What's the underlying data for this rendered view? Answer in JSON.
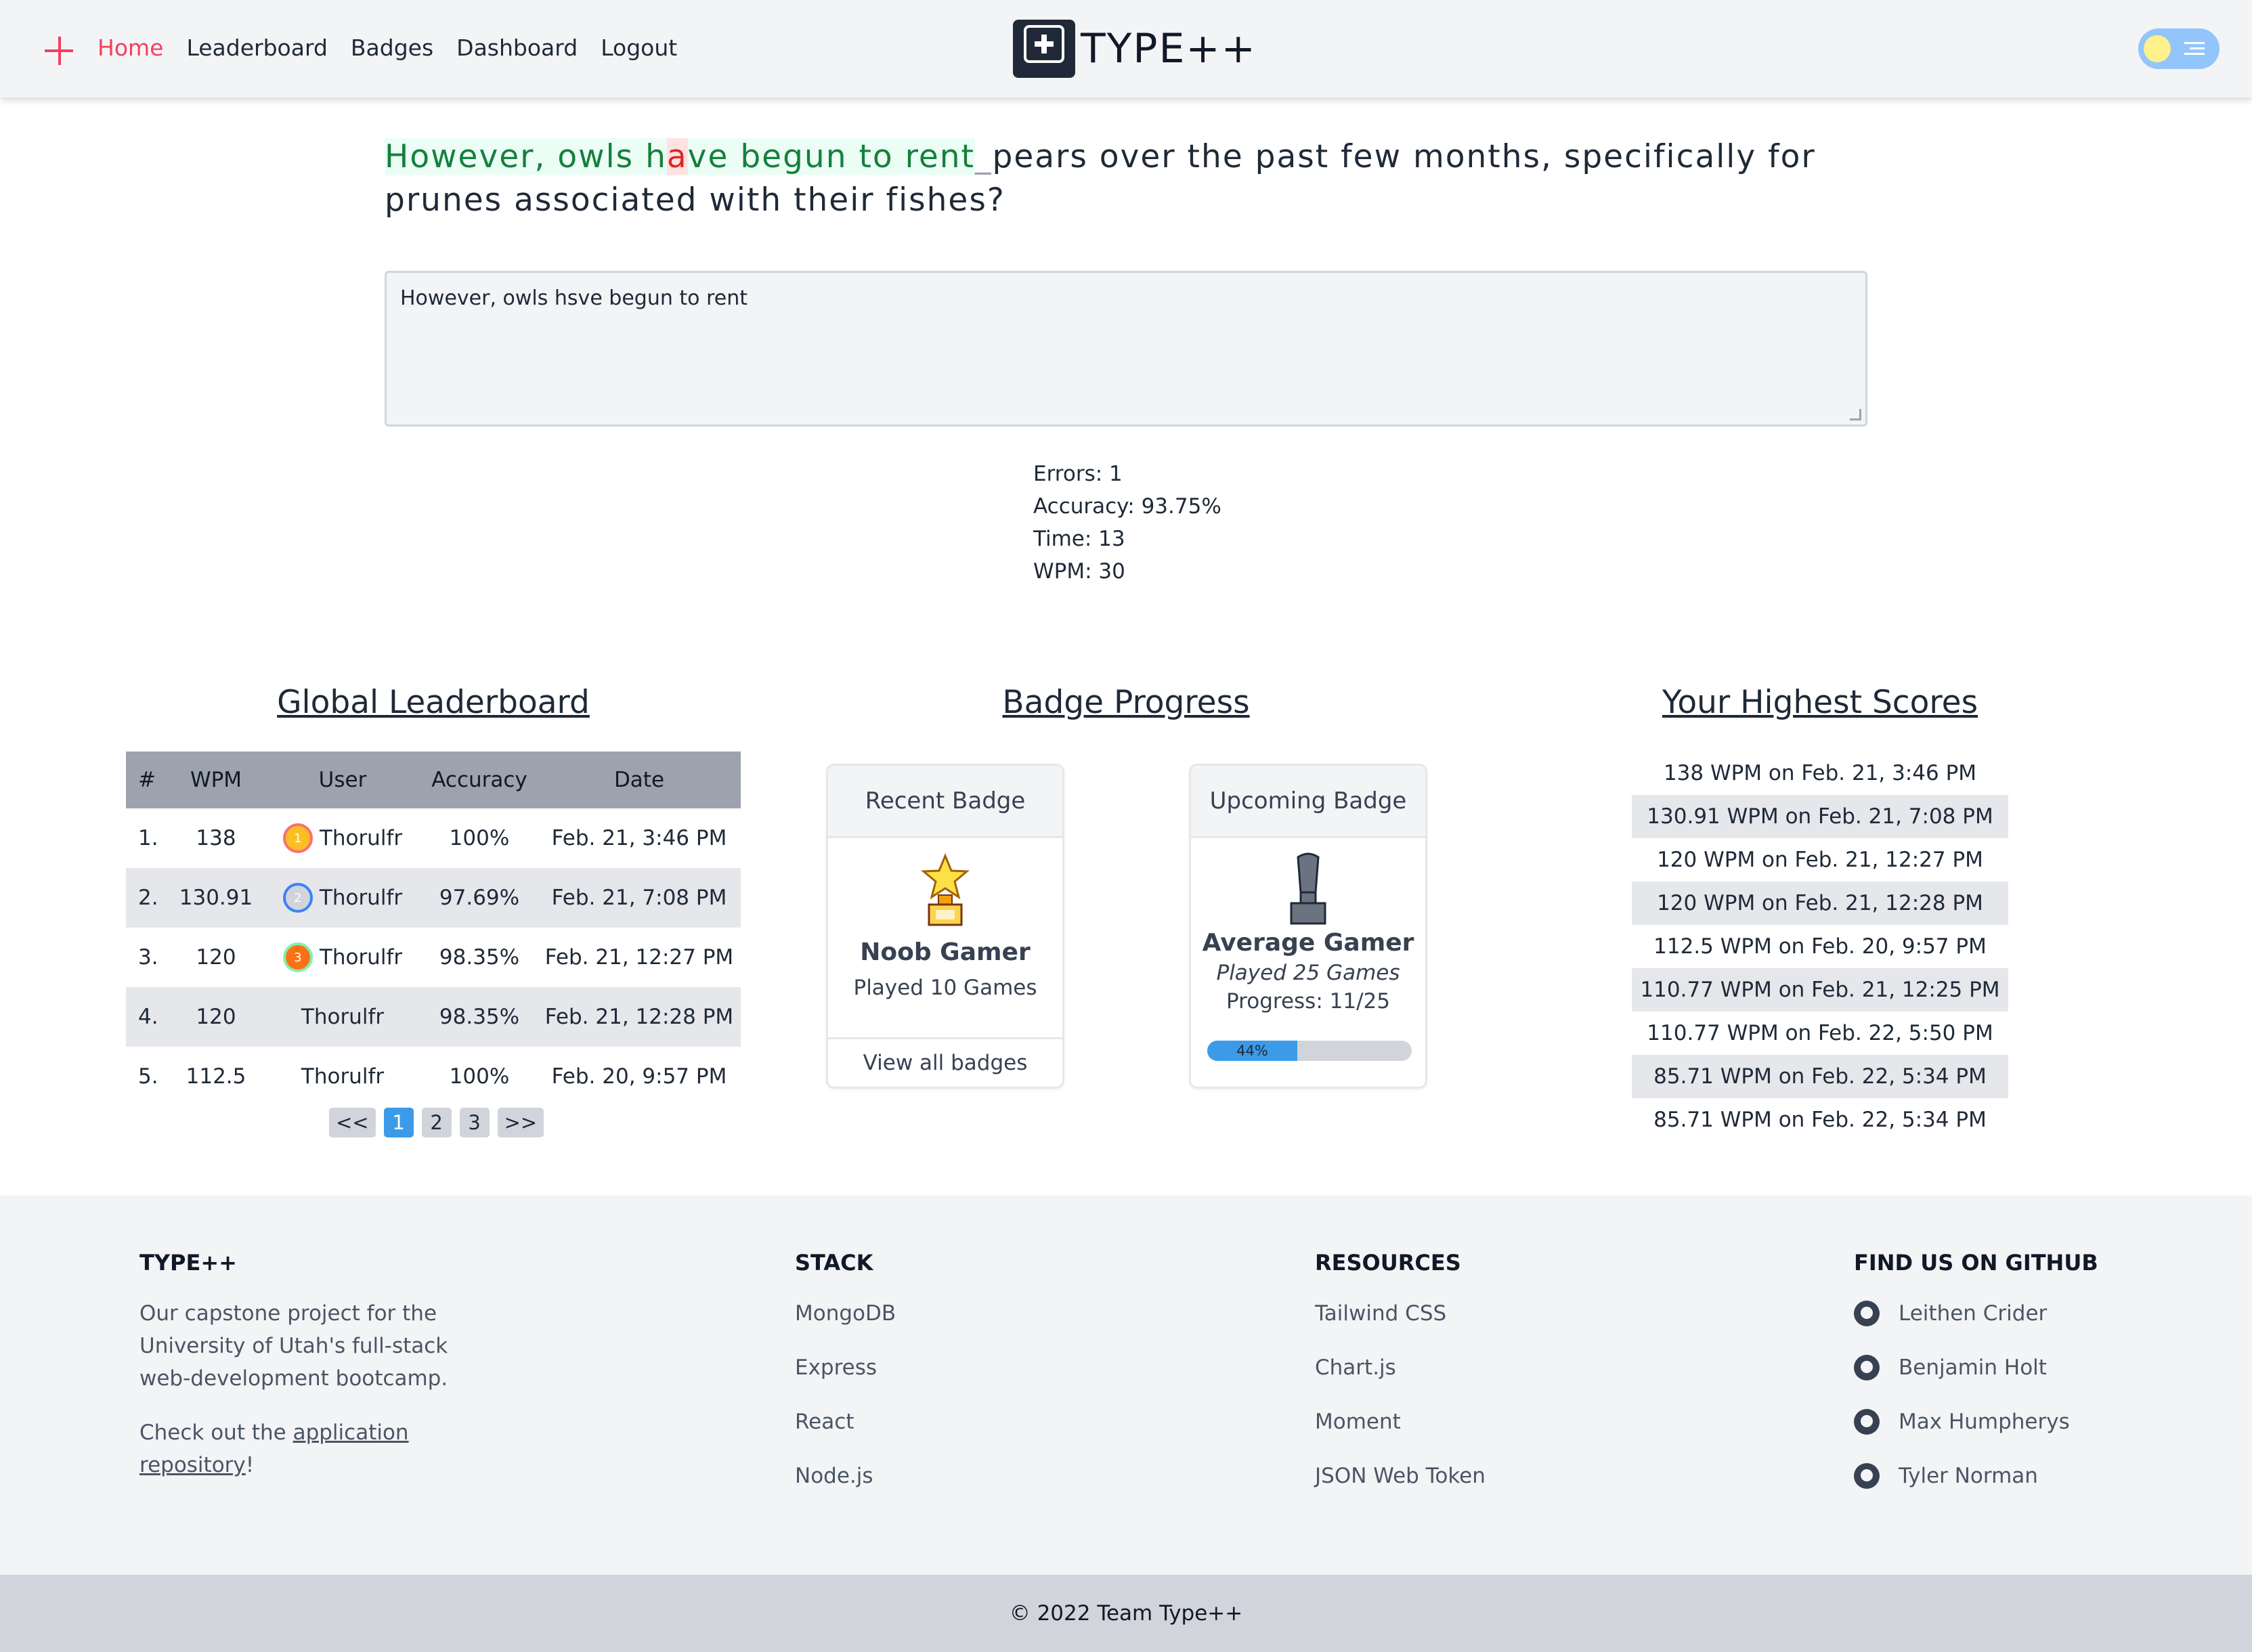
{
  "nav": {
    "links": [
      "Home",
      "Leaderboard",
      "Badges",
      "Dashboard",
      "Logout"
    ],
    "brand": "TYPE++"
  },
  "prompt": {
    "typed_a": "However, owls h",
    "error_char": "a",
    "typed_b": "ve begun to rent",
    "caret": "_",
    "remaining": "pears over the past few months, specifically for prunes associated with their fishes?"
  },
  "input": {
    "value": "However, owls hsve begun to rent"
  },
  "stats": [
    "Errors: 1",
    "Accuracy: 93.75%",
    "Time: 13",
    "WPM: 30"
  ],
  "leaderboard": {
    "title": "Global Leaderboard",
    "headers": [
      "#",
      "WPM",
      "User",
      "Accuracy",
      "Date"
    ],
    "rows": [
      {
        "rank": "1.",
        "wpm": "138",
        "user": "Thorulfr",
        "accuracy": "100%",
        "date": "Feb. 21, 3:46 PM",
        "medal": "1"
      },
      {
        "rank": "2.",
        "wpm": "130.91",
        "user": "Thorulfr",
        "accuracy": "97.69%",
        "date": "Feb. 21, 7:08 PM",
        "medal": "2"
      },
      {
        "rank": "3.",
        "wpm": "120",
        "user": "Thorulfr",
        "accuracy": "98.35%",
        "date": "Feb. 21, 12:27 PM",
        "medal": "3"
      },
      {
        "rank": "4.",
        "wpm": "120",
        "user": "Thorulfr",
        "accuracy": "98.35%",
        "date": "Feb. 21, 12:28 PM"
      },
      {
        "rank": "5.",
        "wpm": "112.5",
        "user": "Thorulfr",
        "accuracy": "100%",
        "date": "Feb. 20, 9:57 PM"
      }
    ],
    "pager": [
      "<<",
      "1",
      "2",
      "3",
      ">>"
    ]
  },
  "badges": {
    "title": "Badge Progress",
    "recent": {
      "heading": "Recent Badge",
      "name": "Noob Gamer",
      "desc": "Played 10 Games",
      "link": "View all badges",
      "icon": "star-trophy-icon"
    },
    "upcoming": {
      "heading": "Upcoming Badge",
      "name": "Average Gamer",
      "desc": "Played 25 Games",
      "progress_text": "Progress: 11/25",
      "progress_percent": 44,
      "progress_label": "44%",
      "icon": "trophy-silhouette-icon"
    }
  },
  "scores": {
    "title": "Your Highest Scores",
    "items": [
      "138 WPM on Feb. 21, 3:46 PM",
      "130.91 WPM on Feb. 21, 7:08 PM",
      "120 WPM on Feb. 21, 12:27 PM",
      "120 WPM on Feb. 21, 12:28 PM",
      "112.5 WPM on Feb. 20, 9:57 PM",
      "110.77 WPM on Feb. 21, 12:25 PM",
      "110.77 WPM on Feb. 22, 5:50 PM",
      "85.71 WPM on Feb. 22, 5:34 PM",
      "85.71 WPM on Feb. 22, 5:34 PM"
    ]
  },
  "footer": {
    "about": {
      "heading": "TYPE++",
      "desc": "Our capstone project for the University of Utah's full-stack web-development bootcamp.",
      "check_prefix": "Check out the ",
      "check_link": "application repository",
      "check_suffix": "!"
    },
    "stack": {
      "heading": "STACK",
      "items": [
        "MongoDB",
        "Express",
        "React",
        "Node.js"
      ]
    },
    "resources": {
      "heading": "RESOURCES",
      "items": [
        "Tailwind CSS",
        "Chart.js",
        "Moment",
        "JSON Web Token"
      ]
    },
    "github": {
      "heading": "FIND US ON GITHUB",
      "items": [
        "Leithen Crider",
        "Benjamin Holt",
        "Max Humpherys",
        "Tyler Norman"
      ]
    },
    "copyright": "© 2022 Team Type++"
  },
  "colors": {
    "accent": "#f43f5e",
    "progress": "#3b9be8",
    "correct": "#15803d",
    "error": "#dc2626"
  }
}
